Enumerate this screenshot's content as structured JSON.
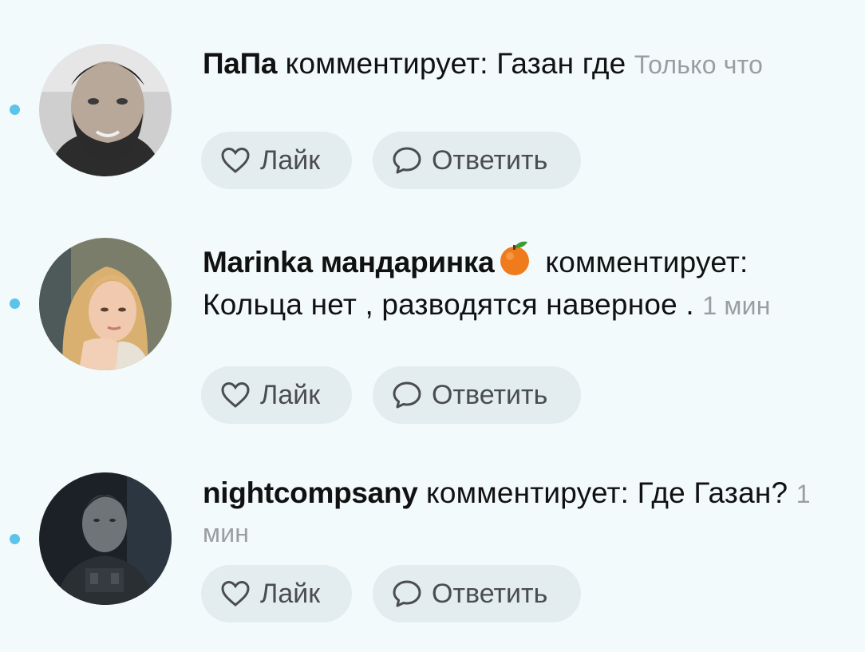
{
  "comments": [
    {
      "author": "ПаПа",
      "text": " комментирует: Газан где ",
      "time": "Только что",
      "emoji": "",
      "like_label": "Лайк",
      "reply_label": "Ответить"
    },
    {
      "author": "Marinka мандаринка",
      "emoji": "orange-emoji",
      "text": "комментирует: Кольца нет , разводятся наверное . ",
      "time": "1 мин",
      "like_label": "Лайк",
      "reply_label": "Ответить"
    },
    {
      "author": "nightcompsany",
      "text": " комментирует: Где Газан? ",
      "time": "1 мин",
      "emoji": "",
      "like_label": "Лайк",
      "reply_label": "Ответить"
    }
  ],
  "colors": {
    "background": "#f3fafc",
    "unread_dot": "#5cc3e9",
    "button_bg": "#e3ecee",
    "time_text": "#9a9ea2"
  },
  "icons": [
    "heart-icon",
    "speech-bubble-icon",
    "unread-dot"
  ]
}
